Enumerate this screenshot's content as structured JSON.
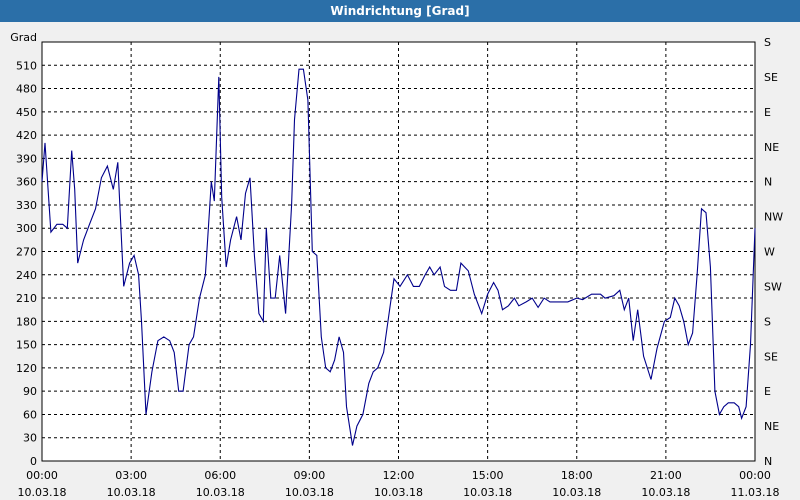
{
  "window": {
    "title": "Windrichtung [Grad]"
  },
  "chart_data": {
    "type": "line",
    "title": "Windrichtung [Grad]",
    "ylabel": "Grad",
    "ylim": [
      0,
      540
    ],
    "yticks": [
      0,
      30,
      60,
      90,
      120,
      150,
      180,
      210,
      240,
      270,
      300,
      330,
      360,
      390,
      420,
      450,
      480,
      510
    ],
    "right_axis_labels": [
      "N",
      "NE",
      "E",
      "SE",
      "S",
      "SW",
      "W",
      "NW",
      "N",
      "NE",
      "E",
      "SE",
      "S"
    ],
    "xlim": [
      0,
      24
    ],
    "xticks": [
      {
        "x": 0,
        "time": "00:00",
        "date": "10.03.18"
      },
      {
        "x": 3,
        "time": "03:00",
        "date": "10.03.18"
      },
      {
        "x": 6,
        "time": "06:00",
        "date": "10.03.18"
      },
      {
        "x": 9,
        "time": "09:00",
        "date": "10.03.18"
      },
      {
        "x": 12,
        "time": "12:00",
        "date": "10.03.18"
      },
      {
        "x": 15,
        "time": "15:00",
        "date": "10.03.18"
      },
      {
        "x": 18,
        "time": "18:00",
        "date": "10.03.18"
      },
      {
        "x": 21,
        "time": "21:00",
        "date": "10.03.18"
      },
      {
        "x": 24,
        "time": "00:00",
        "date": "11.03.18"
      }
    ],
    "grid": true,
    "series": [
      {
        "color": "#00008b",
        "points": [
          [
            0.0,
            360
          ],
          [
            0.1,
            410
          ],
          [
            0.3,
            295
          ],
          [
            0.5,
            305
          ],
          [
            0.7,
            305
          ],
          [
            0.85,
            300
          ],
          [
            1.0,
            400
          ],
          [
            1.1,
            350
          ],
          [
            1.2,
            255
          ],
          [
            1.4,
            285
          ],
          [
            1.6,
            305
          ],
          [
            1.8,
            325
          ],
          [
            2.0,
            365
          ],
          [
            2.2,
            380
          ],
          [
            2.4,
            350
          ],
          [
            2.55,
            385
          ],
          [
            2.75,
            225
          ],
          [
            2.95,
            255
          ],
          [
            3.1,
            265
          ],
          [
            3.25,
            240
          ],
          [
            3.35,
            180
          ],
          [
            3.5,
            60
          ],
          [
            3.7,
            115
          ],
          [
            3.9,
            155
          ],
          [
            4.1,
            160
          ],
          [
            4.3,
            155
          ],
          [
            4.45,
            140
          ],
          [
            4.6,
            90
          ],
          [
            4.75,
            90
          ],
          [
            4.95,
            150
          ],
          [
            5.1,
            160
          ],
          [
            5.3,
            210
          ],
          [
            5.5,
            240
          ],
          [
            5.7,
            360
          ],
          [
            5.8,
            335
          ],
          [
            5.95,
            495
          ],
          [
            6.05,
            340
          ],
          [
            6.2,
            250
          ],
          [
            6.35,
            285
          ],
          [
            6.55,
            315
          ],
          [
            6.7,
            285
          ],
          [
            6.85,
            345
          ],
          [
            7.0,
            365
          ],
          [
            7.15,
            265
          ],
          [
            7.3,
            190
          ],
          [
            7.45,
            180
          ],
          [
            7.55,
            300
          ],
          [
            7.7,
            210
          ],
          [
            7.85,
            210
          ],
          [
            8.0,
            265
          ],
          [
            8.2,
            190
          ],
          [
            8.4,
            330
          ],
          [
            8.5,
            440
          ],
          [
            8.65,
            505
          ],
          [
            8.8,
            505
          ],
          [
            8.95,
            465
          ],
          [
            9.1,
            270
          ],
          [
            9.25,
            265
          ],
          [
            9.4,
            160
          ],
          [
            9.55,
            120
          ],
          [
            9.7,
            115
          ],
          [
            9.85,
            130
          ],
          [
            10.0,
            160
          ],
          [
            10.15,
            140
          ],
          [
            10.25,
            70
          ],
          [
            10.45,
            20
          ],
          [
            10.6,
            45
          ],
          [
            10.8,
            60
          ],
          [
            11.0,
            100
          ],
          [
            11.15,
            115
          ],
          [
            11.3,
            120
          ],
          [
            11.5,
            140
          ],
          [
            11.7,
            195
          ],
          [
            11.85,
            235
          ],
          [
            12.05,
            225
          ],
          [
            12.3,
            240
          ],
          [
            12.5,
            225
          ],
          [
            12.7,
            225
          ],
          [
            12.9,
            240
          ],
          [
            13.05,
            250
          ],
          [
            13.2,
            240
          ],
          [
            13.4,
            250
          ],
          [
            13.55,
            225
          ],
          [
            13.75,
            220
          ],
          [
            13.95,
            220
          ],
          [
            14.1,
            255
          ],
          [
            14.35,
            245
          ],
          [
            14.55,
            215
          ],
          [
            14.8,
            190
          ],
          [
            15.0,
            215
          ],
          [
            15.2,
            230
          ],
          [
            15.35,
            220
          ],
          [
            15.5,
            195
          ],
          [
            15.7,
            200
          ],
          [
            15.9,
            210
          ],
          [
            16.05,
            200
          ],
          [
            16.3,
            205
          ],
          [
            16.5,
            210
          ],
          [
            16.7,
            198
          ],
          [
            16.9,
            210
          ],
          [
            17.1,
            205
          ],
          [
            17.4,
            205
          ],
          [
            17.7,
            205
          ],
          [
            18.0,
            210
          ],
          [
            18.2,
            208
          ],
          [
            18.5,
            215
          ],
          [
            18.8,
            215
          ],
          [
            18.95,
            210
          ],
          [
            19.25,
            213
          ],
          [
            19.45,
            220
          ],
          [
            19.6,
            195
          ],
          [
            19.75,
            210
          ],
          [
            19.9,
            155
          ],
          [
            20.05,
            195
          ],
          [
            20.25,
            135
          ],
          [
            20.5,
            105
          ],
          [
            20.7,
            145
          ],
          [
            20.95,
            180
          ],
          [
            21.15,
            185
          ],
          [
            21.3,
            210
          ],
          [
            21.45,
            200
          ],
          [
            21.6,
            180
          ],
          [
            21.75,
            150
          ],
          [
            21.9,
            165
          ],
          [
            22.05,
            240
          ],
          [
            22.2,
            325
          ],
          [
            22.35,
            320
          ],
          [
            22.5,
            250
          ],
          [
            22.65,
            90
          ],
          [
            22.8,
            60
          ],
          [
            22.95,
            70
          ],
          [
            23.1,
            75
          ],
          [
            23.3,
            75
          ],
          [
            23.45,
            70
          ],
          [
            23.55,
            55
          ],
          [
            23.7,
            70
          ],
          [
            23.85,
            150
          ],
          [
            24.0,
            300
          ]
        ]
      }
    ]
  }
}
